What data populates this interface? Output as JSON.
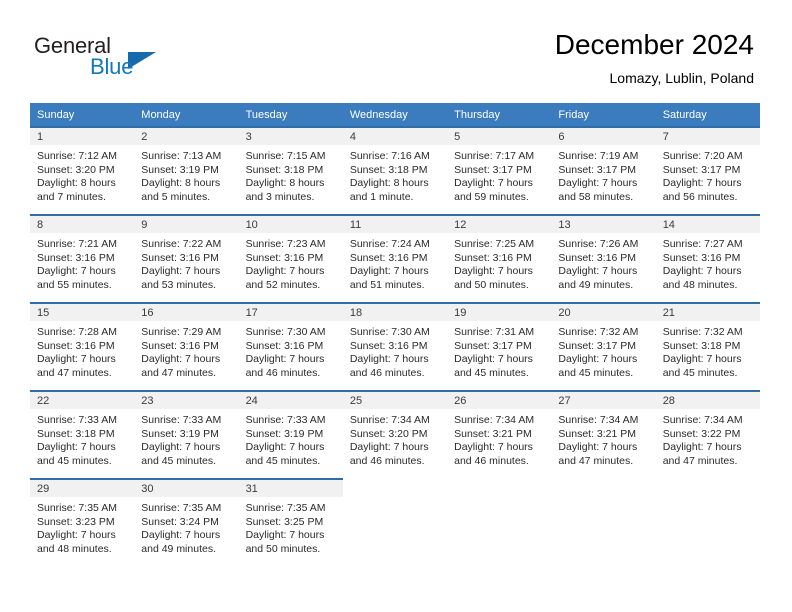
{
  "brand": {
    "line1": "General",
    "line2": "Blue",
    "triangle_color": "#1769ad",
    "blue_text_color": "#1278be",
    "dark_text_color": "#231f20"
  },
  "header": {
    "title": "December 2024",
    "subtitle": "Lomazy, Lublin, Poland"
  },
  "theme": {
    "header_row_bg": "#3a7cbe",
    "cell_top_border": "#2f6ca8",
    "daynum_bg": "#f1f1f1",
    "text": "#2b2b2b"
  },
  "weekday_headers": [
    "Sunday",
    "Monday",
    "Tuesday",
    "Wednesday",
    "Thursday",
    "Friday",
    "Saturday"
  ],
  "weeks": [
    [
      {
        "day": "1",
        "sunrise": "Sunrise: 7:12 AM",
        "sunset": "Sunset: 3:20 PM",
        "daylight1": "Daylight: 8 hours",
        "daylight2": "and 7 minutes."
      },
      {
        "day": "2",
        "sunrise": "Sunrise: 7:13 AM",
        "sunset": "Sunset: 3:19 PM",
        "daylight1": "Daylight: 8 hours",
        "daylight2": "and 5 minutes."
      },
      {
        "day": "3",
        "sunrise": "Sunrise: 7:15 AM",
        "sunset": "Sunset: 3:18 PM",
        "daylight1": "Daylight: 8 hours",
        "daylight2": "and 3 minutes."
      },
      {
        "day": "4",
        "sunrise": "Sunrise: 7:16 AM",
        "sunset": "Sunset: 3:18 PM",
        "daylight1": "Daylight: 8 hours",
        "daylight2": "and 1 minute."
      },
      {
        "day": "5",
        "sunrise": "Sunrise: 7:17 AM",
        "sunset": "Sunset: 3:17 PM",
        "daylight1": "Daylight: 7 hours",
        "daylight2": "and 59 minutes."
      },
      {
        "day": "6",
        "sunrise": "Sunrise: 7:19 AM",
        "sunset": "Sunset: 3:17 PM",
        "daylight1": "Daylight: 7 hours",
        "daylight2": "and 58 minutes."
      },
      {
        "day": "7",
        "sunrise": "Sunrise: 7:20 AM",
        "sunset": "Sunset: 3:17 PM",
        "daylight1": "Daylight: 7 hours",
        "daylight2": "and 56 minutes."
      }
    ],
    [
      {
        "day": "8",
        "sunrise": "Sunrise: 7:21 AM",
        "sunset": "Sunset: 3:16 PM",
        "daylight1": "Daylight: 7 hours",
        "daylight2": "and 55 minutes."
      },
      {
        "day": "9",
        "sunrise": "Sunrise: 7:22 AM",
        "sunset": "Sunset: 3:16 PM",
        "daylight1": "Daylight: 7 hours",
        "daylight2": "and 53 minutes."
      },
      {
        "day": "10",
        "sunrise": "Sunrise: 7:23 AM",
        "sunset": "Sunset: 3:16 PM",
        "daylight1": "Daylight: 7 hours",
        "daylight2": "and 52 minutes."
      },
      {
        "day": "11",
        "sunrise": "Sunrise: 7:24 AM",
        "sunset": "Sunset: 3:16 PM",
        "daylight1": "Daylight: 7 hours",
        "daylight2": "and 51 minutes."
      },
      {
        "day": "12",
        "sunrise": "Sunrise: 7:25 AM",
        "sunset": "Sunset: 3:16 PM",
        "daylight1": "Daylight: 7 hours",
        "daylight2": "and 50 minutes."
      },
      {
        "day": "13",
        "sunrise": "Sunrise: 7:26 AM",
        "sunset": "Sunset: 3:16 PM",
        "daylight1": "Daylight: 7 hours",
        "daylight2": "and 49 minutes."
      },
      {
        "day": "14",
        "sunrise": "Sunrise: 7:27 AM",
        "sunset": "Sunset: 3:16 PM",
        "daylight1": "Daylight: 7 hours",
        "daylight2": "and 48 minutes."
      }
    ],
    [
      {
        "day": "15",
        "sunrise": "Sunrise: 7:28 AM",
        "sunset": "Sunset: 3:16 PM",
        "daylight1": "Daylight: 7 hours",
        "daylight2": "and 47 minutes."
      },
      {
        "day": "16",
        "sunrise": "Sunrise: 7:29 AM",
        "sunset": "Sunset: 3:16 PM",
        "daylight1": "Daylight: 7 hours",
        "daylight2": "and 47 minutes."
      },
      {
        "day": "17",
        "sunrise": "Sunrise: 7:30 AM",
        "sunset": "Sunset: 3:16 PM",
        "daylight1": "Daylight: 7 hours",
        "daylight2": "and 46 minutes."
      },
      {
        "day": "18",
        "sunrise": "Sunrise: 7:30 AM",
        "sunset": "Sunset: 3:16 PM",
        "daylight1": "Daylight: 7 hours",
        "daylight2": "and 46 minutes."
      },
      {
        "day": "19",
        "sunrise": "Sunrise: 7:31 AM",
        "sunset": "Sunset: 3:17 PM",
        "daylight1": "Daylight: 7 hours",
        "daylight2": "and 45 minutes."
      },
      {
        "day": "20",
        "sunrise": "Sunrise: 7:32 AM",
        "sunset": "Sunset: 3:17 PM",
        "daylight1": "Daylight: 7 hours",
        "daylight2": "and 45 minutes."
      },
      {
        "day": "21",
        "sunrise": "Sunrise: 7:32 AM",
        "sunset": "Sunset: 3:18 PM",
        "daylight1": "Daylight: 7 hours",
        "daylight2": "and 45 minutes."
      }
    ],
    [
      {
        "day": "22",
        "sunrise": "Sunrise: 7:33 AM",
        "sunset": "Sunset: 3:18 PM",
        "daylight1": "Daylight: 7 hours",
        "daylight2": "and 45 minutes."
      },
      {
        "day": "23",
        "sunrise": "Sunrise: 7:33 AM",
        "sunset": "Sunset: 3:19 PM",
        "daylight1": "Daylight: 7 hours",
        "daylight2": "and 45 minutes."
      },
      {
        "day": "24",
        "sunrise": "Sunrise: 7:33 AM",
        "sunset": "Sunset: 3:19 PM",
        "daylight1": "Daylight: 7 hours",
        "daylight2": "and 45 minutes."
      },
      {
        "day": "25",
        "sunrise": "Sunrise: 7:34 AM",
        "sunset": "Sunset: 3:20 PM",
        "daylight1": "Daylight: 7 hours",
        "daylight2": "and 46 minutes."
      },
      {
        "day": "26",
        "sunrise": "Sunrise: 7:34 AM",
        "sunset": "Sunset: 3:21 PM",
        "daylight1": "Daylight: 7 hours",
        "daylight2": "and 46 minutes."
      },
      {
        "day": "27",
        "sunrise": "Sunrise: 7:34 AM",
        "sunset": "Sunset: 3:21 PM",
        "daylight1": "Daylight: 7 hours",
        "daylight2": "and 47 minutes."
      },
      {
        "day": "28",
        "sunrise": "Sunrise: 7:34 AM",
        "sunset": "Sunset: 3:22 PM",
        "daylight1": "Daylight: 7 hours",
        "daylight2": "and 47 minutes."
      }
    ],
    [
      {
        "day": "29",
        "sunrise": "Sunrise: 7:35 AM",
        "sunset": "Sunset: 3:23 PM",
        "daylight1": "Daylight: 7 hours",
        "daylight2": "and 48 minutes."
      },
      {
        "day": "30",
        "sunrise": "Sunrise: 7:35 AM",
        "sunset": "Sunset: 3:24 PM",
        "daylight1": "Daylight: 7 hours",
        "daylight2": "and 49 minutes."
      },
      {
        "day": "31",
        "sunrise": "Sunrise: 7:35 AM",
        "sunset": "Sunset: 3:25 PM",
        "daylight1": "Daylight: 7 hours",
        "daylight2": "and 50 minutes."
      },
      {
        "day": "",
        "sunrise": "",
        "sunset": "",
        "daylight1": "",
        "daylight2": ""
      },
      {
        "day": "",
        "sunrise": "",
        "sunset": "",
        "daylight1": "",
        "daylight2": ""
      },
      {
        "day": "",
        "sunrise": "",
        "sunset": "",
        "daylight1": "",
        "daylight2": ""
      },
      {
        "day": "",
        "sunrise": "",
        "sunset": "",
        "daylight1": "",
        "daylight2": ""
      }
    ]
  ]
}
